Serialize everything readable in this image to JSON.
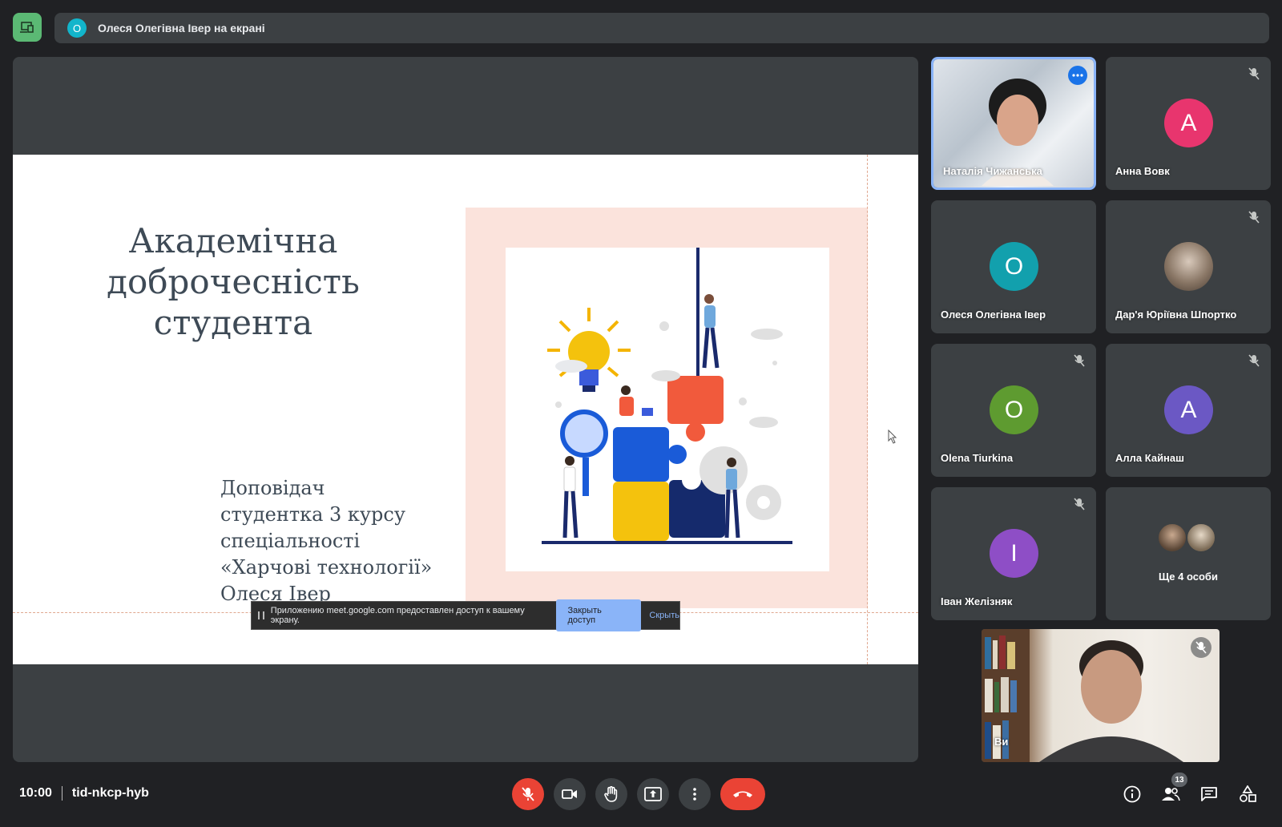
{
  "header": {
    "presenter_initial": "О",
    "presenting_text": "Олеся Олегівна Івер на екрані"
  },
  "slide": {
    "title_lines": [
      "Академічна",
      "доброчесність",
      "студента"
    ],
    "subtitle_lines": [
      "Доповідач",
      "студентка 3 курсу",
      "спеціальності",
      "«Харчові технології»",
      "Олеся Івер"
    ]
  },
  "share_bar": {
    "text": "Приложению meet.google.com предоставлен доступ к вашему экрану.",
    "stop_label": "Закрыть доступ",
    "hide_label": "Скрыть"
  },
  "participants": [
    {
      "name": "Наталія Чижанська",
      "type": "video",
      "active_speaker": true
    },
    {
      "name": "Анна Вовк",
      "initial": "А",
      "color": "#e8356e",
      "muted": true
    },
    {
      "name": "Олеся Олегівна Івер",
      "initial": "О",
      "color": "#12a0ad",
      "muted": false
    },
    {
      "name": "Дар'я Юріївна Шпортко",
      "type": "photo",
      "muted": true
    },
    {
      "name": "Olena Tiurkina",
      "initial": "O",
      "color": "#5e9b30",
      "muted": true
    },
    {
      "name": "Алла Кайнаш",
      "initial": "А",
      "color": "#6b58c4",
      "muted": true
    },
    {
      "name": "Іван Желізняк",
      "initial": "І",
      "color": "#8e4ec6",
      "muted": true
    },
    {
      "name": "Ще 4 особи",
      "type": "more"
    }
  ],
  "self_view": {
    "name": "Ви",
    "muted": true
  },
  "footer": {
    "time": "10:00",
    "meeting_code": "tid-nkcp-hyb",
    "people_count": "13"
  },
  "colors": {
    "background": "#202124",
    "tile": "#3c4043",
    "accent_blue": "#8ab4f8",
    "danger_red": "#ea4335"
  }
}
